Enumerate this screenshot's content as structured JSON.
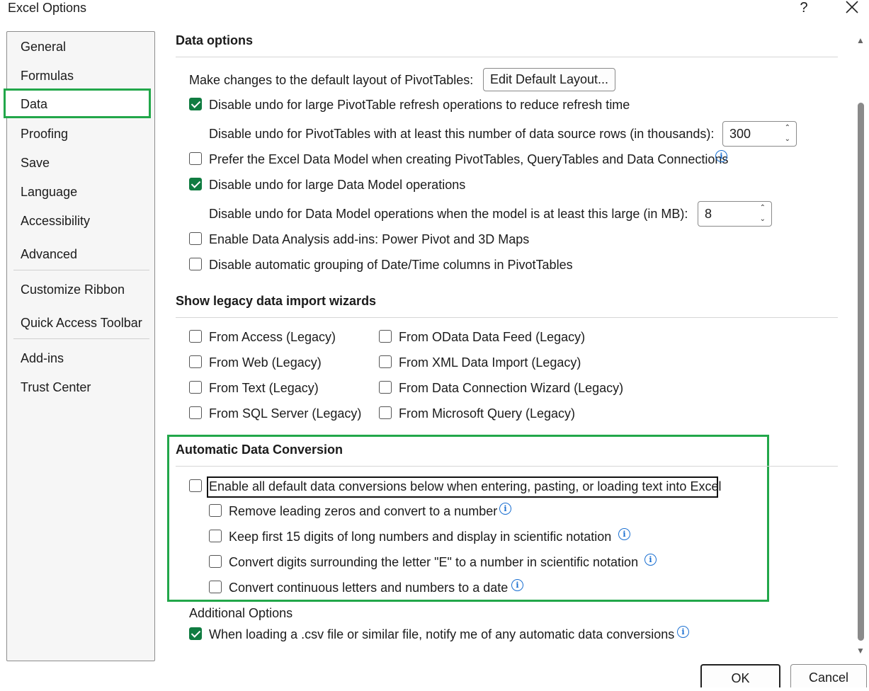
{
  "window": {
    "title": "Excel Options",
    "help_label": "?"
  },
  "sidebar": {
    "items": [
      {
        "label": "General"
      },
      {
        "label": "Formulas"
      },
      {
        "label": "Data"
      },
      {
        "label": "Proofing"
      },
      {
        "label": "Save"
      },
      {
        "label": "Language"
      },
      {
        "label": "Accessibility"
      },
      {
        "label": "Advanced"
      },
      {
        "label": "Customize Ribbon"
      },
      {
        "label": "Quick Access Toolbar"
      },
      {
        "label": "Add-ins"
      },
      {
        "label": "Trust Center"
      }
    ],
    "selected": "Data"
  },
  "data_options": {
    "title": "Data options",
    "pivot_layout_label": "Make changes to the default layout of PivotTables:",
    "edit_layout_button": "Edit Default Layout...",
    "disable_undo_pivot": {
      "label": "Disable undo for large PivotTable refresh operations to reduce refresh time",
      "checked": true
    },
    "pivot_rows_label": "Disable undo for PivotTables with at least this number of data source rows (in thousands):",
    "pivot_rows_value": "300",
    "prefer_data_model": {
      "label": "Prefer the Excel Data Model when creating PivotTables, QueryTables and Data Connections",
      "checked": false
    },
    "disable_undo_model": {
      "label": "Disable undo for large Data Model operations",
      "checked": true
    },
    "model_size_label": "Disable undo for Data Model operations when the model is at least this large (in MB):",
    "model_size_value": "8",
    "enable_addins": {
      "label": "Enable Data Analysis add-ins: Power Pivot and 3D Maps",
      "checked": false
    },
    "disable_grouping": {
      "label": "Disable automatic grouping of Date/Time columns in PivotTables",
      "checked": false
    }
  },
  "legacy": {
    "title": "Show legacy data import wizards",
    "left": [
      {
        "label": "From Access (Legacy)",
        "checked": false
      },
      {
        "label": "From Web (Legacy)",
        "checked": false
      },
      {
        "label": "From Text (Legacy)",
        "checked": false
      },
      {
        "label": "From SQL Server (Legacy)",
        "checked": false
      }
    ],
    "right": [
      {
        "label": "From OData Data Feed (Legacy)",
        "checked": false
      },
      {
        "label": "From XML Data Import (Legacy)",
        "checked": false
      },
      {
        "label": "From Data Connection Wizard (Legacy)",
        "checked": false
      },
      {
        "label": "From Microsoft Query (Legacy)",
        "checked": false
      }
    ]
  },
  "conversion": {
    "title": "Automatic Data Conversion",
    "enable_all": {
      "label": "Enable all default data conversions below when entering, pasting, or loading text into Excel",
      "checked": false
    },
    "options": [
      {
        "label": "Remove leading zeros and convert to a number",
        "checked": false
      },
      {
        "label": "Keep first 15 digits of long numbers and display in scientific notation",
        "checked": false
      },
      {
        "label": "Convert digits surrounding the letter \"E\" to a number in scientific notation",
        "checked": false
      },
      {
        "label": "Convert continuous letters and numbers to a date",
        "checked": false
      }
    ]
  },
  "additional": {
    "title": "Additional Options",
    "notify_csv": {
      "label": "When loading a .csv file or similar file, notify me of any automatic data conversions",
      "checked": true
    }
  },
  "footer": {
    "ok_label": "OK",
    "cancel_label": "Cancel"
  },
  "icons": {
    "info": "info-icon",
    "close": "close-icon"
  },
  "colors": {
    "accent_green": "#107c41",
    "highlight_green": "#22a74a",
    "info_blue": "#1a6fd1"
  }
}
